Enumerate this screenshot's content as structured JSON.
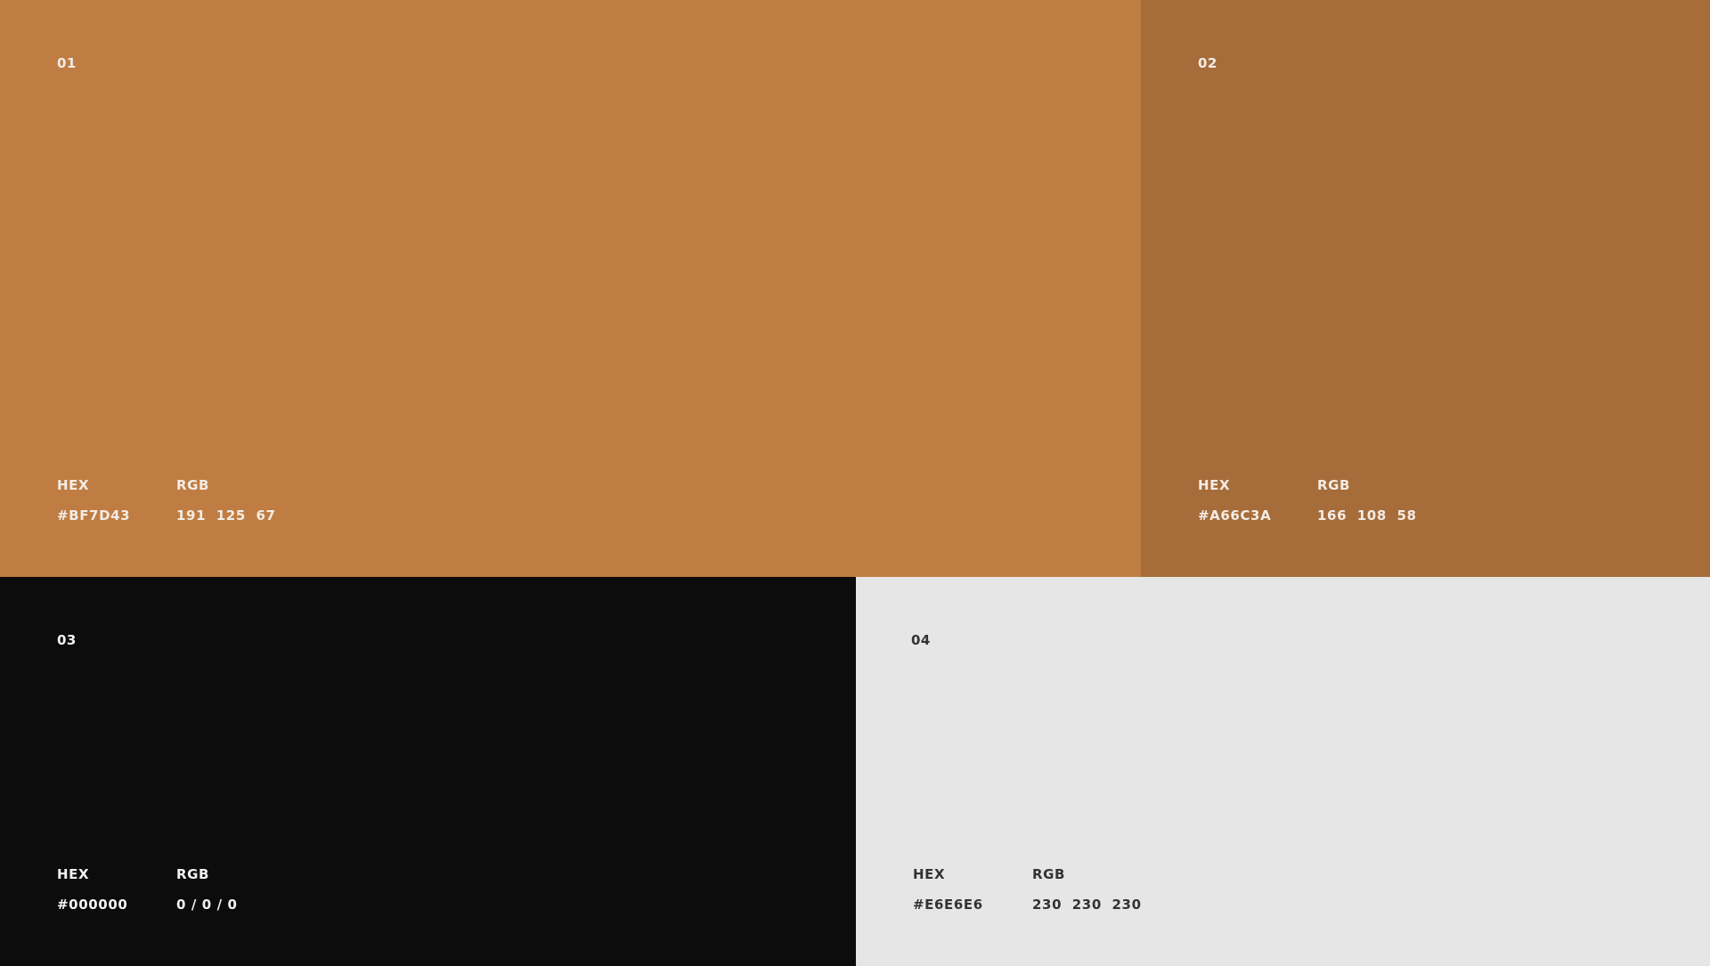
{
  "swatches": [
    {
      "number": "01",
      "hex_label": "HEX",
      "rgb_label": "RGB",
      "hex": "#BF7D43",
      "rgb": "191  125  67",
      "color": "#BF7D43"
    },
    {
      "number": "02",
      "hex_label": "HEX",
      "rgb_label": "RGB",
      "hex": "#A66C3A",
      "rgb": "166  108  58",
      "color": "#A66C3A"
    },
    {
      "number": "03",
      "hex_label": "HEX",
      "rgb_label": "RGB",
      "hex": "#000000",
      "rgb": "0 / 0 / 0",
      "color": "#0C0C0C"
    },
    {
      "number": "04",
      "hex_label": "HEX",
      "rgb_label": "RGB",
      "hex": "#E6E6E6",
      "rgb": "230  230  230",
      "color": "#E6E6E6"
    }
  ]
}
